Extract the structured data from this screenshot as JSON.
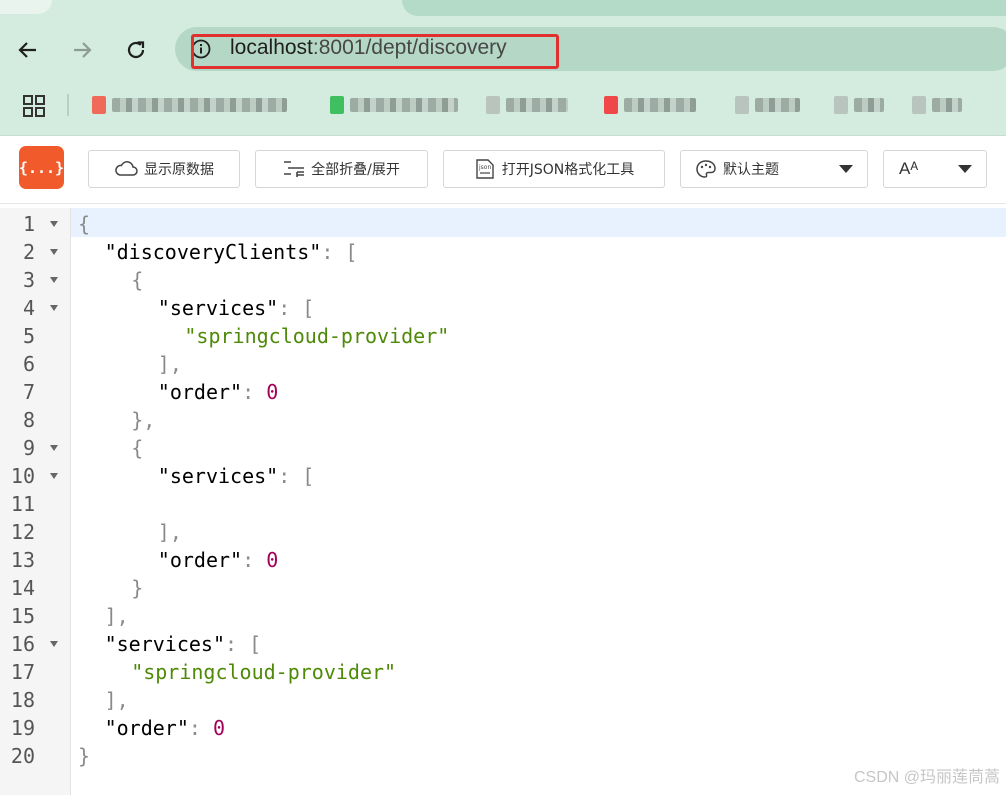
{
  "browser": {
    "url_host": "localhost",
    "url_rest": ":8001/dept/discovery",
    "bookmarks": [
      {
        "icon_color": "#f06a5a",
        "text_w": 175
      },
      {
        "icon_color": "#3fbf5f",
        "text_w": 108
      },
      {
        "icon_color": "#b9c4be",
        "text_w": 62
      },
      {
        "icon_color": "#f04848",
        "text_w": 72
      },
      {
        "icon_color": "#b9c4be",
        "text_w": 45
      },
      {
        "icon_color": "#b9c4be",
        "text_w": 30
      },
      {
        "icon_color": "#b9c4be",
        "text_w": 30
      }
    ]
  },
  "viewer": {
    "logo_text": "{...}",
    "show_raw": "显示原数据",
    "fold_toggle": "全部折叠/展开",
    "open_formatter": "打开JSON格式化工具",
    "theme": "默认主题",
    "font_size": "Aᴬ"
  },
  "lines": [
    {
      "n": "1",
      "fold": true,
      "indent": 0,
      "tokens": [
        {
          "c": "p",
          "t": "{"
        }
      ]
    },
    {
      "n": "2",
      "fold": true,
      "indent": 1,
      "tokens": [
        {
          "c": "k",
          "t": "\"discoveryClients\""
        },
        {
          "c": "p",
          "t": ": ["
        }
      ]
    },
    {
      "n": "3",
      "fold": true,
      "indent": 2,
      "tokens": [
        {
          "c": "p",
          "t": "{"
        }
      ]
    },
    {
      "n": "4",
      "fold": true,
      "indent": 3,
      "tokens": [
        {
          "c": "k",
          "t": "\"services\""
        },
        {
          "c": "p",
          "t": ": ["
        }
      ]
    },
    {
      "n": "5",
      "fold": false,
      "indent": 4,
      "tokens": [
        {
          "c": "s",
          "t": "\"springcloud-provider\""
        }
      ]
    },
    {
      "n": "6",
      "fold": false,
      "indent": 3,
      "tokens": [
        {
          "c": "p",
          "t": "],"
        }
      ]
    },
    {
      "n": "7",
      "fold": false,
      "indent": 3,
      "tokens": [
        {
          "c": "k",
          "t": "\"order\""
        },
        {
          "c": "p",
          "t": ": "
        },
        {
          "c": "n",
          "t": "0"
        }
      ]
    },
    {
      "n": "8",
      "fold": false,
      "indent": 2,
      "tokens": [
        {
          "c": "p",
          "t": "},"
        }
      ]
    },
    {
      "n": "9",
      "fold": true,
      "indent": 2,
      "tokens": [
        {
          "c": "p",
          "t": "{"
        }
      ]
    },
    {
      "n": "10",
      "fold": true,
      "indent": 3,
      "tokens": [
        {
          "c": "k",
          "t": "\"services\""
        },
        {
          "c": "p",
          "t": ": ["
        }
      ]
    },
    {
      "n": "11",
      "fold": false,
      "indent": 0,
      "tokens": []
    },
    {
      "n": "12",
      "fold": false,
      "indent": 3,
      "tokens": [
        {
          "c": "p",
          "t": "],"
        }
      ]
    },
    {
      "n": "13",
      "fold": false,
      "indent": 3,
      "tokens": [
        {
          "c": "k",
          "t": "\"order\""
        },
        {
          "c": "p",
          "t": ": "
        },
        {
          "c": "n",
          "t": "0"
        }
      ]
    },
    {
      "n": "14",
      "fold": false,
      "indent": 2,
      "tokens": [
        {
          "c": "p",
          "t": "}"
        }
      ]
    },
    {
      "n": "15",
      "fold": false,
      "indent": 1,
      "tokens": [
        {
          "c": "p",
          "t": "],"
        }
      ]
    },
    {
      "n": "16",
      "fold": true,
      "indent": 1,
      "tokens": [
        {
          "c": "k",
          "t": "\"services\""
        },
        {
          "c": "p",
          "t": ": ["
        }
      ]
    },
    {
      "n": "17",
      "fold": false,
      "indent": 2,
      "tokens": [
        {
          "c": "s",
          "t": "\"springcloud-provider\""
        }
      ]
    },
    {
      "n": "18",
      "fold": false,
      "indent": 1,
      "tokens": [
        {
          "c": "p",
          "t": "],"
        }
      ]
    },
    {
      "n": "19",
      "fold": false,
      "indent": 1,
      "tokens": [
        {
          "c": "k",
          "t": "\"order\""
        },
        {
          "c": "p",
          "t": ": "
        },
        {
          "c": "n",
          "t": "0"
        }
      ]
    },
    {
      "n": "20",
      "fold": false,
      "indent": 0,
      "tokens": [
        {
          "c": "p",
          "t": "}"
        }
      ]
    }
  ],
  "watermark": "CSDN @玛丽莲茼蒿"
}
